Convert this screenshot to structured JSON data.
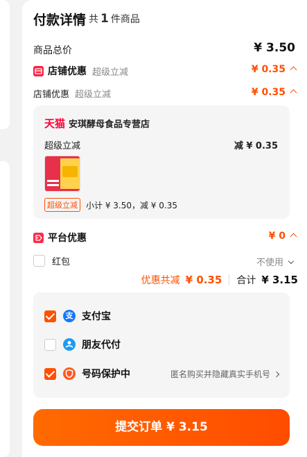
{
  "header": {
    "title": "付款详情",
    "count_prefix": "共",
    "count": "1",
    "count_suffix": "件商品"
  },
  "summary": {
    "total_label": "商品总价",
    "total_value": "¥ 3.50"
  },
  "store_discount": {
    "label": "店铺优惠",
    "sub": "超级立减",
    "value": "¥ 0.35",
    "detail_label": "店铺优惠",
    "detail_sub": "超级立减",
    "detail_value": "¥ 0.35"
  },
  "store": {
    "brand": "天猫",
    "name": "安琪酵母食品专营店",
    "promo_label": "超级立减",
    "promo_value": "减 ¥ 0.35",
    "tag": "超级立减",
    "subtotal": "小计 ¥ 3.50，减 ¥ 0.35"
  },
  "platform_discount": {
    "label": "平台优惠",
    "value": "¥ 0"
  },
  "red_packet": {
    "label": "红包",
    "status": "不使用"
  },
  "totals": {
    "saved_label": "优惠共减",
    "saved_value": "¥ 0.35",
    "sum_label": "合计",
    "sum_value": "¥ 3.15"
  },
  "payment": {
    "alipay": "支付宝",
    "friend_pay": "朋友代付",
    "privacy_label": "号码保护中",
    "privacy_desc": "匿名购买并隐藏真实手机号"
  },
  "submit": {
    "label": "提交订单 ¥ 3.15"
  },
  "colors": {
    "accent": "#ff5000",
    "tmall": "#ff0036",
    "alipay": "#1677ff"
  }
}
